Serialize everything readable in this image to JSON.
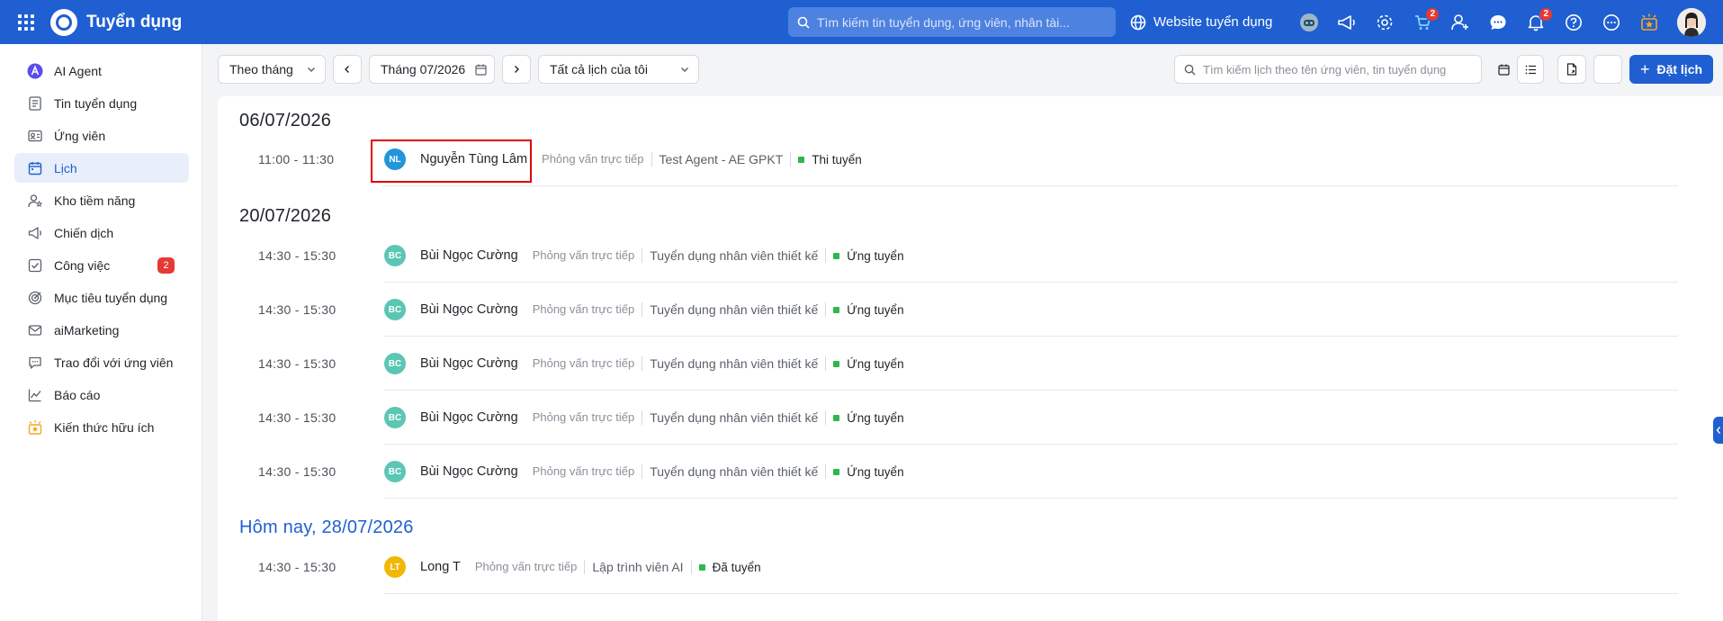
{
  "header": {
    "app_title": "Tuyển dụng",
    "search_placeholder": "Tìm kiếm tin tuyển dụng, ứng viên, nhân tài...",
    "website_link": "Website tuyển dụng",
    "cart_badge": "2",
    "notification_badge": "2"
  },
  "sidebar": {
    "items": [
      {
        "label": "AI Agent",
        "icon": "ai-agent-icon"
      },
      {
        "label": "Tin tuyển dụng",
        "icon": "job-post-icon"
      },
      {
        "label": "Ứng viên",
        "icon": "candidate-icon"
      },
      {
        "label": "Lịch",
        "icon": "calendar-icon",
        "active": true
      },
      {
        "label": "Kho tiềm năng",
        "icon": "talent-pool-icon"
      },
      {
        "label": "Chiến dịch",
        "icon": "campaign-icon"
      },
      {
        "label": "Công việc",
        "icon": "task-icon",
        "badge": "2"
      },
      {
        "label": "Mục tiêu tuyển dụng",
        "icon": "target-icon"
      },
      {
        "label": "aiMarketing",
        "icon": "marketing-icon"
      },
      {
        "label": "Trao đổi với ứng viên",
        "icon": "chat-icon"
      },
      {
        "label": "Báo cáo",
        "icon": "report-icon"
      },
      {
        "label": "Kiến thức hữu ích",
        "icon": "knowledge-icon"
      }
    ]
  },
  "toolbar": {
    "view_mode": "Theo tháng",
    "current_month": "Tháng 07/2026",
    "scope": "Tất cả lịch của tôi",
    "search_placeholder": "Tìm kiếm lịch theo tên ứng viên, tin tuyển dụng",
    "book_button": "Đặt lịch"
  },
  "schedule": {
    "days": [
      {
        "heading": "06/07/2026",
        "events": [
          {
            "time": "11:00 - 11:30",
            "initials": "NL",
            "avatar_color": "#2196d9",
            "name": "Nguyễn Tùng Lâm",
            "type": "Phỏng vấn trực tiếp",
            "job": "Test Agent - AE GPKT",
            "status": "Thi tuyển"
          }
        ]
      },
      {
        "heading": "20/07/2026",
        "events": [
          {
            "time": "14:30 - 15:30",
            "initials": "BC",
            "avatar_color": "#5cc6b4",
            "name": "Bùi Ngọc Cường",
            "type": "Phỏng vấn trực tiếp",
            "job": "Tuyển dụng nhân viên thiết kế",
            "status": "Ứng tuyển"
          },
          {
            "time": "14:30 - 15:30",
            "initials": "BC",
            "avatar_color": "#5cc6b4",
            "name": "Bùi Ngọc Cường",
            "type": "Phỏng vấn trực tiếp",
            "job": "Tuyển dụng nhân viên thiết kế",
            "status": "Ứng tuyển"
          },
          {
            "time": "14:30 - 15:30",
            "initials": "BC",
            "avatar_color": "#5cc6b4",
            "name": "Bùi Ngọc Cường",
            "type": "Phỏng vấn trực tiếp",
            "job": "Tuyển dụng nhân viên thiết kế",
            "status": "Ứng tuyển"
          },
          {
            "time": "14:30 - 15:30",
            "initials": "BC",
            "avatar_color": "#5cc6b4",
            "name": "Bùi Ngọc Cường",
            "type": "Phỏng vấn trực tiếp",
            "job": "Tuyển dụng nhân viên thiết kế",
            "status": "Ứng tuyển"
          },
          {
            "time": "14:30 - 15:30",
            "initials": "BC",
            "avatar_color": "#5cc6b4",
            "name": "Bùi Ngọc Cường",
            "type": "Phỏng vấn trực tiếp",
            "job": "Tuyển dụng nhân viên thiết kế",
            "status": "Ứng tuyển"
          }
        ]
      },
      {
        "heading": "Hôm nay, 28/07/2026",
        "today": true,
        "events": [
          {
            "time": "14:30 - 15:30",
            "initials": "LT",
            "avatar_color": "#f2b705",
            "name": "Long T",
            "type": "Phỏng vấn trực tiếp",
            "job": "Lập trình viên AI",
            "status": "Đã tuyển"
          }
        ]
      }
    ]
  },
  "colors": {
    "brand": "#1f5fd1",
    "status_green": "#2db84d",
    "badge_red": "#e53935",
    "highlight_red": "#e00000"
  }
}
